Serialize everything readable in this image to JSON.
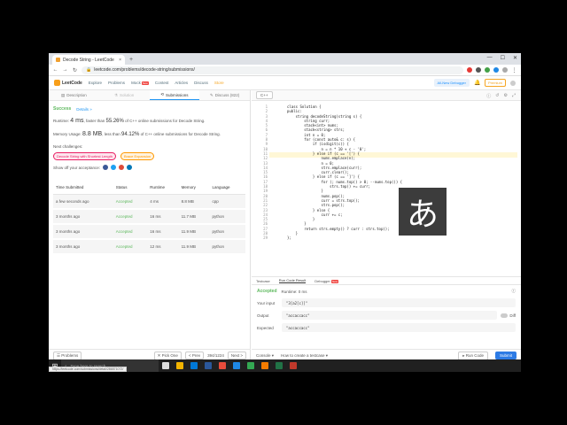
{
  "browser": {
    "tab_title": "Decode String - LeetCode",
    "tab_close": "×",
    "new_tab": "+",
    "url": "leetcode.com/problems/decode-string/submissions/",
    "win_controls": [
      "—",
      "☐",
      "✕"
    ]
  },
  "nav": {
    "brand": "LeetCode",
    "items": [
      "Explore",
      "Problems",
      "Mock",
      "Contest",
      "Articles",
      "Discuss",
      "Store"
    ],
    "new_badge": "New",
    "debugger_btn": "All-New Debugger",
    "premium": "Premium"
  },
  "left_tabs": [
    "Description",
    "Solution",
    "Submissions",
    "Discuss (822)"
  ],
  "result": {
    "status": "Success",
    "details": "Details »",
    "runtime_label": "Runtime:",
    "runtime_value": "4 ms",
    "runtime_mid": ", faster than",
    "runtime_pct": "55.26%",
    "runtime_tail": "of C++ online submissions for Decode String.",
    "memory_label": "Memory Usage:",
    "memory_value": "8.8 MB",
    "memory_mid": ", less than",
    "memory_pct": "94.12%",
    "memory_tail": "of C++ online submissions for Decode String.",
    "next_challenges": "Next challenges:",
    "chips": [
      "Decode String with Shortest Length",
      "Brace Expansion"
    ],
    "share_label": "Show off your acceptance:"
  },
  "share_colors": [
    "#3b5998",
    "#1da1f2",
    "#dd4b39",
    "#0077b5"
  ],
  "submissions": {
    "headers": [
      "Time Submitted",
      "Status",
      "Runtime",
      "Memory",
      "Language"
    ],
    "rows": [
      [
        "a few seconds ago",
        "Accepted",
        "4 ms",
        "8.8 MB",
        "cpp"
      ],
      [
        "3 months ago",
        "Accepted",
        "16 ms",
        "11.7 MB",
        "python"
      ],
      [
        "3 months ago",
        "Accepted",
        "16 ms",
        "11.9 MB",
        "python"
      ],
      [
        "3 months ago",
        "Accepted",
        "12 ms",
        "11.9 MB",
        "python"
      ]
    ]
  },
  "left_footer": {
    "problems": "☰ Problems",
    "pick_one": "✕ Pick One",
    "prev": "< Prev",
    "page": "394/1224",
    "next": "Next >"
  },
  "status_url": "https://leetcode.com/submissions/detail/286571072/",
  "editor": {
    "language": "C++",
    "line_numbers": [
      "1",
      "2",
      "3",
      "4",
      "5",
      "6",
      "7",
      "8",
      "9",
      "10",
      "11",
      "12",
      "13",
      "14",
      "15",
      "16",
      "17",
      "18",
      "19",
      "20",
      "21",
      "22",
      "23",
      "24",
      "25",
      "26",
      "27",
      "28",
      "29"
    ],
    "code_lines": [
      "class Solution {",
      "public:",
      "    string decodeString(string s) {",
      "        string curr;",
      "        stack<int> nums;",
      "        stack<string> strs;",
      "        int n = 0;",
      "        for (const auto& c: s) {",
      "            if (isdigit(c)) {",
      "                n = n * 10 + c - '0';",
      "            } else if (c == '[') {",
      "                nums.emplace(n);",
      "                n = 0;",
      "                strs.emplace(curr);",
      "                curr.clear();",
      "            } else if (c == ']') {",
      "                for (; nums.top() > 0; --nums.top()) {",
      "                    strs.top() += curr;",
      "                }",
      "                nums.pop();",
      "                curr = strs.top();",
      "                strs.pop();",
      "            } else {",
      "                curr += c;",
      "            }",
      "        }",
      "        return strs.empty() ? curr : strs.top();",
      "    }",
      "};"
    ]
  },
  "ime_char": "あ",
  "console": {
    "tabs": [
      "Testcase",
      "Run Code Result",
      "Debugger"
    ],
    "new_badge": "New",
    "status": "Accepted",
    "runtime": "Runtime: 0 ms",
    "input_label": "Your input",
    "input_value": "\"3[a2[c]]\"",
    "output_label": "Output",
    "output_value": "\"accaccacc\"",
    "diff_label": "Diff",
    "expected_label": "Expected",
    "expected_value": "\"accaccacc\""
  },
  "right_footer": {
    "console": "Console ▾",
    "howto": "How to create a testcase ▾",
    "run": "▸ Run Code",
    "submit": "Submit"
  },
  "taskbar": {
    "search_placeholder": "Type here to search",
    "app_colors": [
      "#dddddd",
      "#f4b400",
      "#0078d7",
      "#2b579a",
      "#e74c3c",
      "#1e88e5",
      "#34a853",
      "#f57c00",
      "#217346",
      "#c0392b"
    ]
  }
}
